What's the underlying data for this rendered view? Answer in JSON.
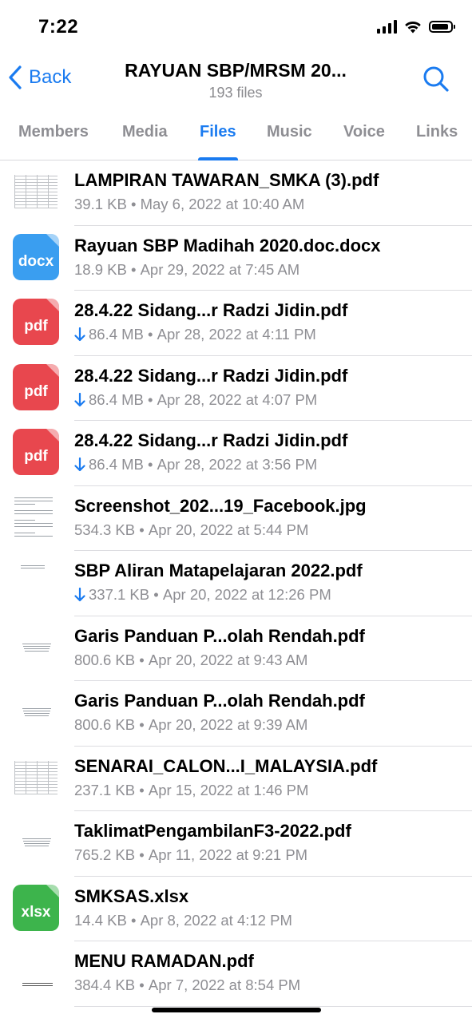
{
  "status_bar": {
    "time": "7:22"
  },
  "nav": {
    "back_label": "Back",
    "title": "RAYUAN SBP/MRSM 20...",
    "subtitle": "193 files"
  },
  "tabs": [
    {
      "label": "Members",
      "active": false
    },
    {
      "label": "Media",
      "active": false
    },
    {
      "label": "Files",
      "active": true
    },
    {
      "label": "Music",
      "active": false
    },
    {
      "label": "Voice",
      "active": false
    },
    {
      "label": "Links",
      "active": false
    }
  ],
  "files": [
    {
      "name": "LAMPIRAN TAWARAN_SMKA (3).pdf",
      "size": "39.1 KB",
      "date": "May 6, 2022 at 10:40 AM",
      "thumb": "table-preview",
      "downloaded": true
    },
    {
      "name": "Rayuan SBP Madihah 2020.doc.docx",
      "size": "18.9 KB",
      "date": "Apr 29, 2022 at 7:45 AM",
      "thumb": "docx",
      "downloaded": true
    },
    {
      "name": "28.4.22 Sidang...r Radzi Jidin.pdf",
      "size": "86.4 MB",
      "date": "Apr 28, 2022 at 4:11 PM",
      "thumb": "pdf",
      "downloaded": false
    },
    {
      "name": "28.4.22 Sidang...r Radzi Jidin.pdf",
      "size": "86.4 MB",
      "date": "Apr 28, 2022 at 4:07 PM",
      "thumb": "pdf",
      "downloaded": false
    },
    {
      "name": "28.4.22 Sidang...r Radzi Jidin.pdf",
      "size": "86.4 MB",
      "date": "Apr 28, 2022 at 3:56 PM",
      "thumb": "pdf",
      "downloaded": false
    },
    {
      "name": "Screenshot_202...19_Facebook.jpg",
      "size": "534.3 KB",
      "date": "Apr 20, 2022 at 5:44 PM",
      "thumb": "text-preview",
      "downloaded": true
    },
    {
      "name": "SBP Aliran Matapelajaran 2022.pdf",
      "size": "337.1 KB",
      "date": "Apr 20, 2022 at 12:26 PM",
      "thumb": "blank-preview",
      "downloaded": false
    },
    {
      "name": "Garis Panduan P...olah Rendah.pdf",
      "size": "800.6 KB",
      "date": "Apr 20, 2022 at 9:43 AM",
      "thumb": "center-preview",
      "downloaded": true
    },
    {
      "name": "Garis Panduan P...olah Rendah.pdf",
      "size": "800.6 KB",
      "date": "Apr 20, 2022 at 9:39 AM",
      "thumb": "center-preview",
      "downloaded": true
    },
    {
      "name": "SENARAI_CALON...I_MALAYSIA.pdf",
      "size": "237.1 KB",
      "date": "Apr 15, 2022 at 1:46 PM",
      "thumb": "table-preview",
      "downloaded": true
    },
    {
      "name": "TaklimatPengambilanF3-2022.pdf",
      "size": "765.2 KB",
      "date": "Apr 11, 2022 at 9:21 PM",
      "thumb": "center-preview",
      "downloaded": true
    },
    {
      "name": "SMKSAS.xlsx",
      "size": "14.4 KB",
      "date": "Apr 8, 2022 at 4:12 PM",
      "thumb": "xlsx",
      "downloaded": true
    },
    {
      "name": "MENU RAMADAN.pdf",
      "size": "384.4 KB",
      "date": "Apr 7, 2022 at 8:54 PM",
      "thumb": "bottom-preview",
      "downloaded": true
    }
  ],
  "thumb_labels": {
    "pdf": "pdf",
    "docx": "docx",
    "xlsx": "xlsx"
  },
  "colors": {
    "accent": "#1a7bf0",
    "pdf": "#e8474e",
    "docx": "#3a9ef0",
    "xlsx": "#3db44c",
    "secondary_text": "#8e8e93"
  }
}
